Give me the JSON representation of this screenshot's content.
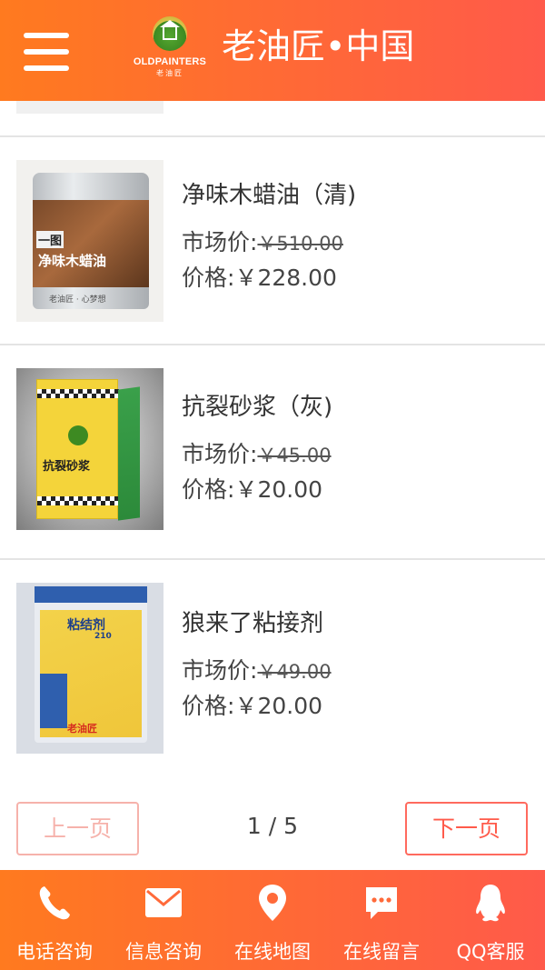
{
  "header": {
    "title": "老油匠•中国",
    "logo_en": "OLDPAINTERS",
    "logo_cn": "老油匠"
  },
  "products": [
    {
      "name": "净味木蜡油（清)",
      "market_label": "市场价:",
      "market_price": "￥510.00",
      "price_label": "价格:",
      "price": "￥228.00",
      "thumb_text": "净味木蜡油",
      "thumb_brand": "一图",
      "thumb_footer": "老油匠 · 心梦想"
    },
    {
      "name": "抗裂砂浆（灰)",
      "market_label": "市场价:",
      "market_price": "￥45.00",
      "price_label": "价格:",
      "price": "￥20.00",
      "thumb_text": "抗裂砂浆"
    },
    {
      "name": "狼来了粘接剂",
      "market_label": "市场价:",
      "market_price": "￥49.00",
      "price_label": "价格:",
      "price": "￥20.00",
      "thumb_text": "粘结剂",
      "thumb_sub": "210",
      "thumb_brand": "老油匠"
    }
  ],
  "pagination": {
    "prev_label": "上一页",
    "next_label": "下一页",
    "current_page": 1,
    "total_pages": 5,
    "info": "1 / 5"
  },
  "bottom_nav": [
    {
      "label": "电话咨询",
      "icon": "phone-icon"
    },
    {
      "label": "信息咨询",
      "icon": "mail-icon"
    },
    {
      "label": "在线地图",
      "icon": "map-pin-icon"
    },
    {
      "label": "在线留言",
      "icon": "chat-bubble-icon"
    },
    {
      "label": "QQ客服",
      "icon": "qq-penguin-icon"
    }
  ],
  "colors": {
    "accent_start": "#ff7a1f",
    "accent_end": "#ff5a4a",
    "prev_disabled": "#f6b2ab"
  }
}
